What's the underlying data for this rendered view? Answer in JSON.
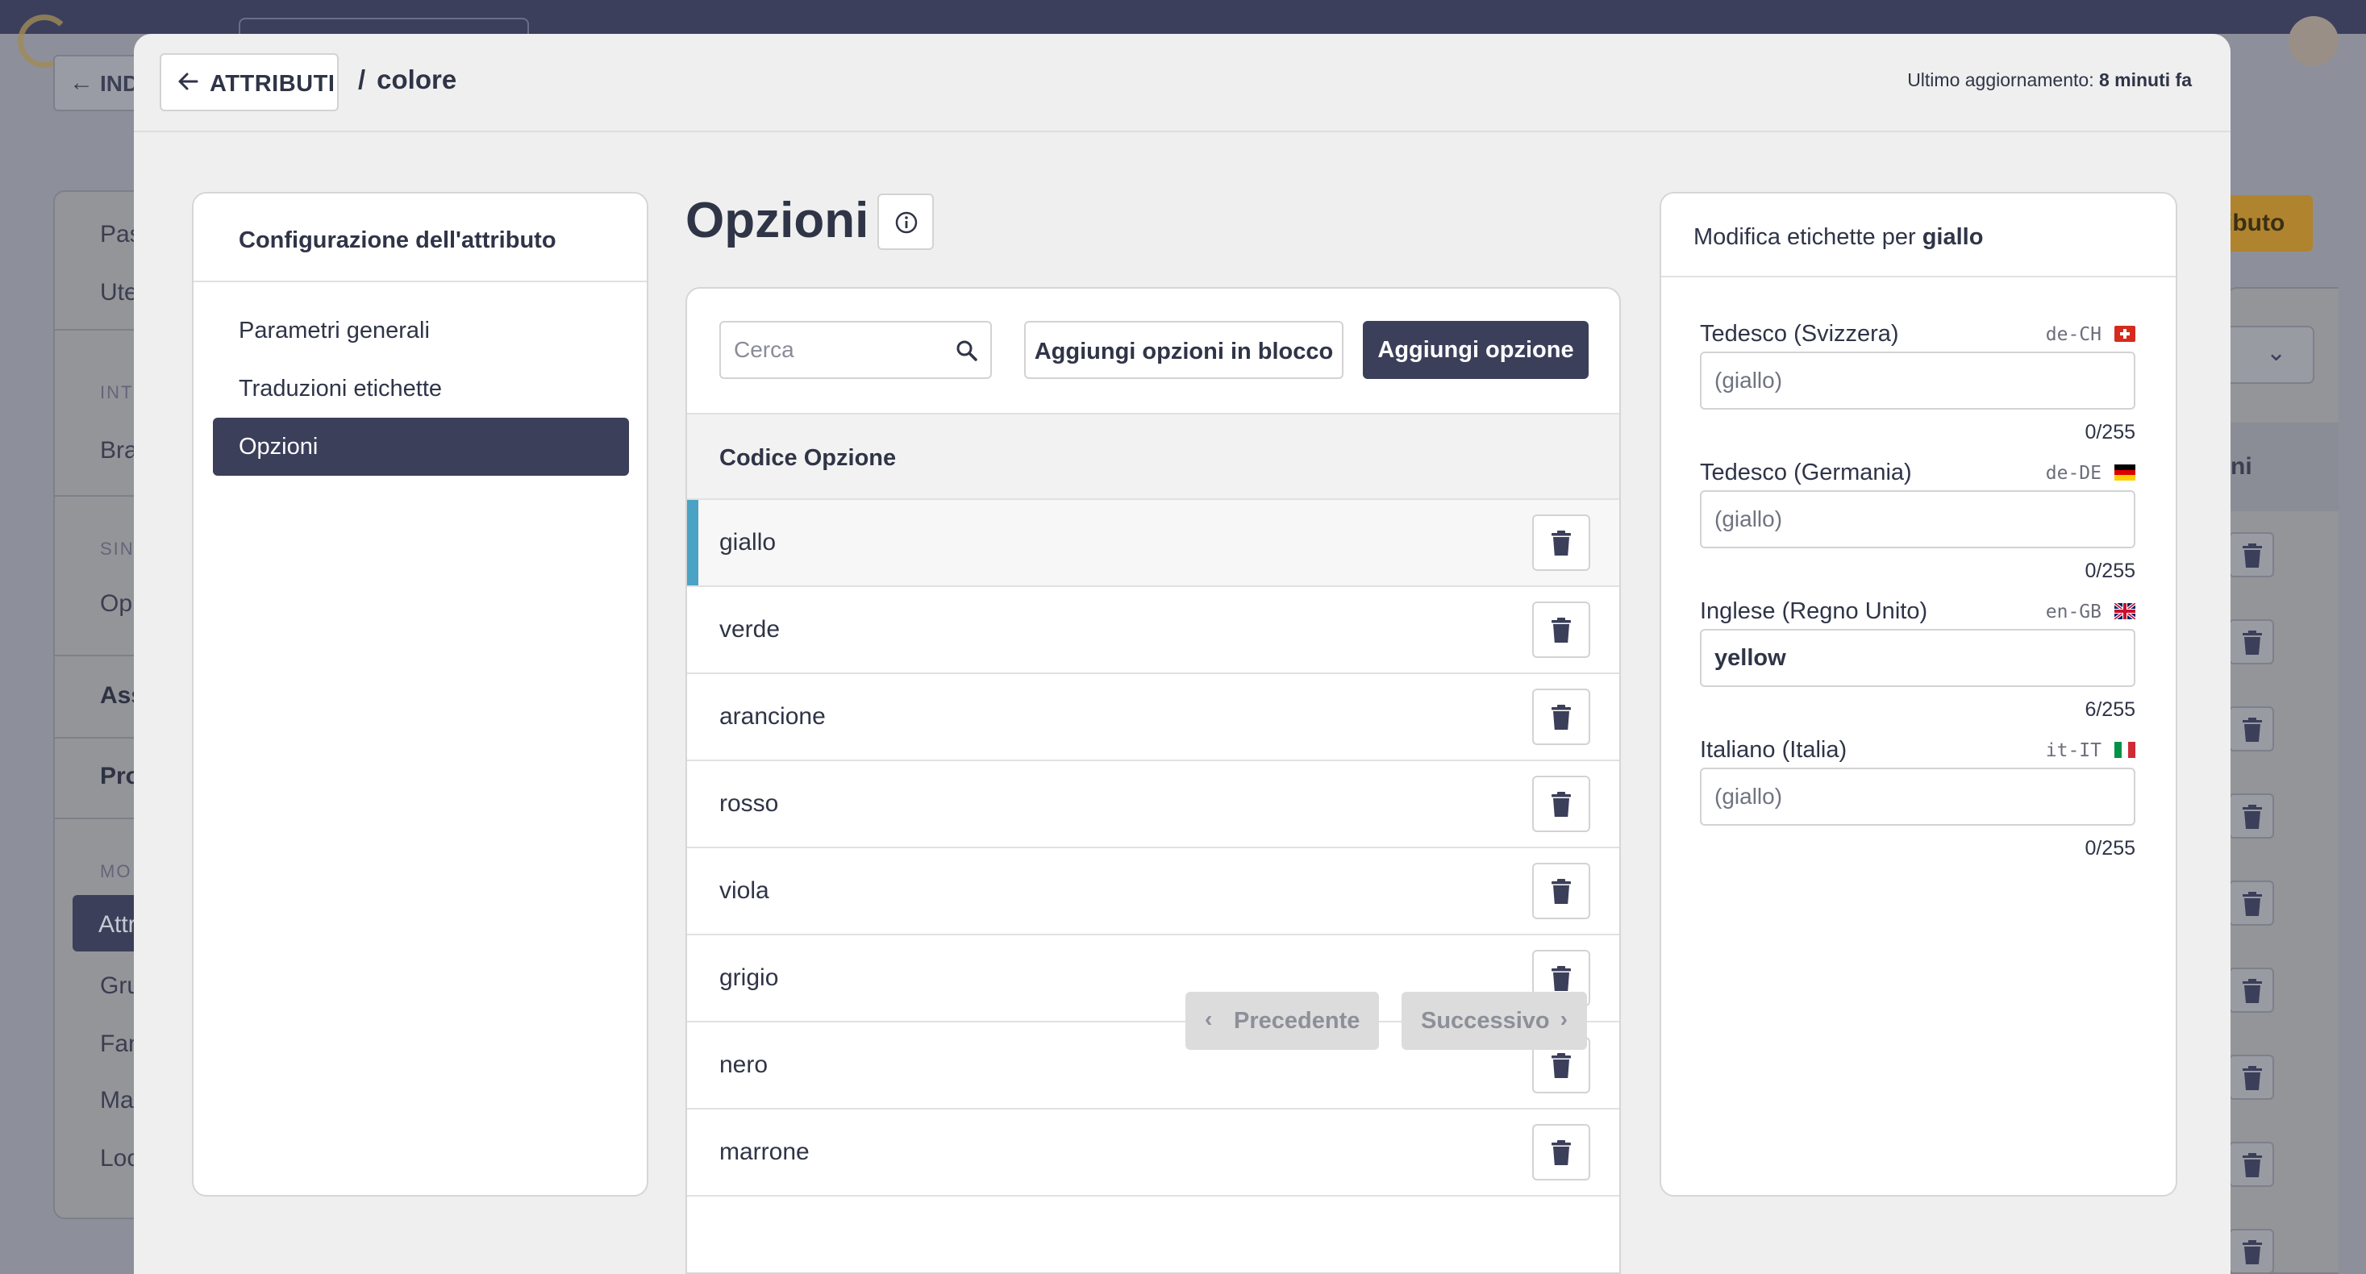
{
  "background": {
    "back_label": "IND",
    "sidebar": [
      "Pas",
      "Ute",
      "INT",
      "Bra",
      "SIN",
      "Op",
      "Ass",
      "Pro",
      "MO",
      "Attr",
      "Gru",
      "Fan",
      "Mar",
      "Loc"
    ],
    "orange_button": "ibuto",
    "column_header": "ni"
  },
  "header": {
    "back_label": "ATTRIBUTI",
    "separator": "/",
    "attribute_name": "colore",
    "updated_prefix": "Ultimo aggiornamento:",
    "updated_value": "8 minuti fa"
  },
  "config": {
    "title": "Configurazione dell'attributo",
    "items": [
      {
        "label": "Parametri generali",
        "active": false
      },
      {
        "label": "Traduzioni etichette",
        "active": false
      },
      {
        "label": "Opzioni",
        "active": true
      }
    ]
  },
  "options": {
    "title": "Opzioni",
    "search_placeholder": "Cerca",
    "bulk_add_label": "Aggiungi opzioni in blocco",
    "add_label": "Aggiungi opzione",
    "column_header": "Codice Opzione",
    "rows": [
      {
        "code": "giallo",
        "selected": true
      },
      {
        "code": "verde",
        "selected": false
      },
      {
        "code": "arancione",
        "selected": false
      },
      {
        "code": "rosso",
        "selected": false
      },
      {
        "code": "viola",
        "selected": false
      },
      {
        "code": "grigio",
        "selected": false
      },
      {
        "code": "nero",
        "selected": false
      },
      {
        "code": "marrone",
        "selected": false
      }
    ],
    "prev_label": "Precedente",
    "next_label": "Successivo"
  },
  "labels_panel": {
    "title_prefix": "Modifica etichette per",
    "title_option": "giallo",
    "fields": [
      {
        "name": "Tedesco (Svizzera)",
        "locale": "de-CH",
        "flag": "flag-ch-icon",
        "value": "",
        "placeholder": "(giallo)",
        "count": "0/255"
      },
      {
        "name": "Tedesco (Germania)",
        "locale": "de-DE",
        "flag": "flag-de-icon",
        "value": "",
        "placeholder": "(giallo)",
        "count": "0/255"
      },
      {
        "name": "Inglese (Regno Unito)",
        "locale": "en-GB",
        "flag": "flag-gb-icon",
        "value": "yellow",
        "placeholder": "(giallo)",
        "count": "6/255"
      },
      {
        "name": "Italiano (Italia)",
        "locale": "it-IT",
        "flag": "flag-it-icon",
        "value": "",
        "placeholder": "(giallo)",
        "count": "0/255"
      }
    ]
  },
  "colors": {
    "primary_dark": "#3b3f5a",
    "selected_accent": "#4aa3c4",
    "modal_background": "#efefef",
    "overlay_background": "#8d909b"
  }
}
